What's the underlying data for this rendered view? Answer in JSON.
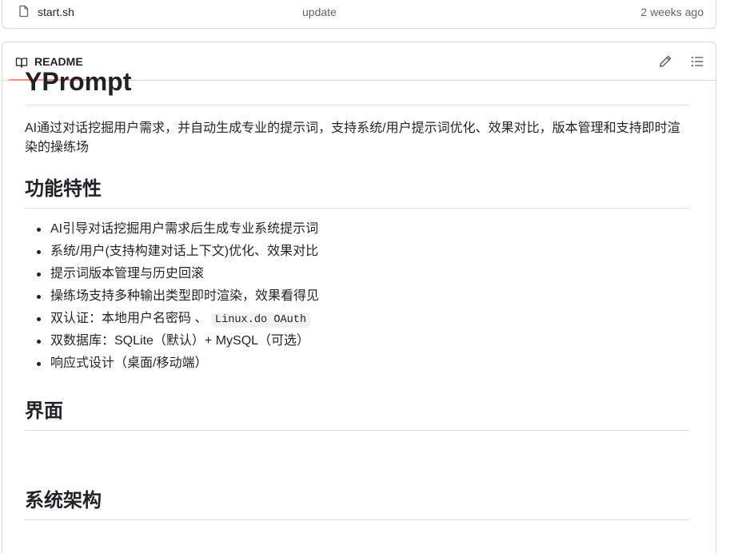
{
  "file_row": {
    "name": "start.sh",
    "commit_message": "update",
    "age": "2 weeks ago"
  },
  "readme": {
    "tab_label": "README",
    "title": "YPrompt",
    "description": "AI通过对话挖掘用户需求，并自动生成专业的提示词，支持系统/用户提示词优化、效果对比，版本管理和支持即时渲染的操练场",
    "sections": {
      "features_heading": "功能特性",
      "features": [
        {
          "text": "AI引导对话挖掘用户需求后生成专业系统提示词"
        },
        {
          "text": "系统/用户(支持构建对话上下文)优化、效果对比"
        },
        {
          "text": "提示词版本管理与历史回滚"
        },
        {
          "text": "操练场支持多种输出类型即时渲染，效果看得见"
        },
        {
          "text": "双认证：本地用户名密码 、",
          "code": "Linux.do OAuth"
        },
        {
          "text": "双数据库：SQLite（默认）+ MySQL（可选）"
        },
        {
          "text": "响应式设计（桌面/移动端）"
        }
      ],
      "ui_heading": "界面",
      "arch_heading": "系统架构"
    }
  },
  "colors": {
    "text": "#1f2328",
    "muted": "#59636e",
    "border": "#d0d7de",
    "tab_underline": "#fd8c73"
  },
  "icons": {
    "file": "file-icon",
    "book": "book-icon",
    "edit": "pencil-icon",
    "toc": "list-unordered-icon"
  }
}
